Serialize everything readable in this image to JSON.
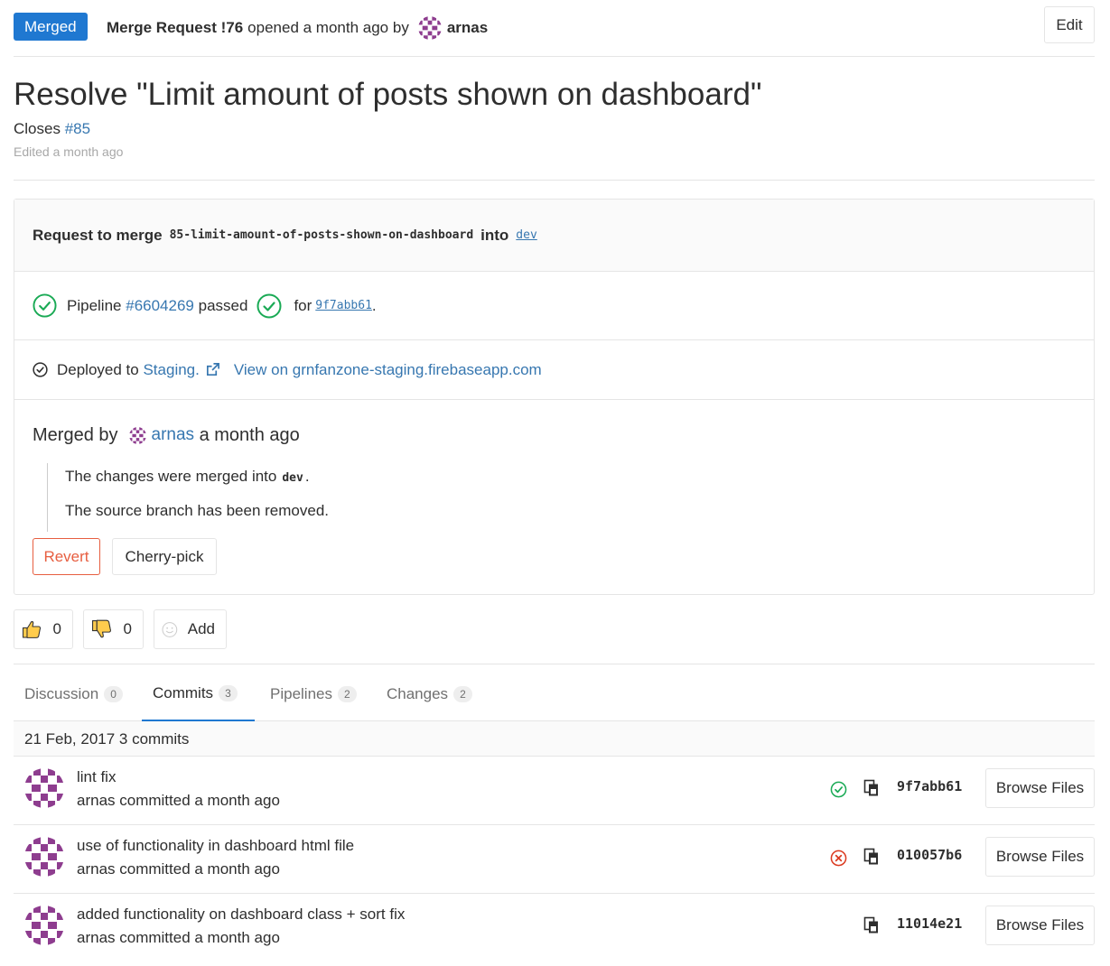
{
  "header": {
    "status_badge": "Merged",
    "mr_label": "Merge Request !76",
    "opened_text": "opened a month ago by",
    "author": "arnas",
    "edit_label": "Edit"
  },
  "title": "Resolve \"Limit amount of posts shown on dashboard\"",
  "closes": {
    "prefix": "Closes",
    "issue": "#85"
  },
  "edited": "Edited a month ago",
  "widget": {
    "request_prefix": "Request to merge",
    "source_branch": "85-limit-amount-of-posts-shown-on-dashboard",
    "into": "into",
    "target_branch": "dev",
    "pipeline_label": "Pipeline",
    "pipeline_id": "#6604269",
    "pipeline_status": "passed",
    "for_label": "for",
    "commit_sha": "9f7abb61",
    "deployed_prefix": "Deployed to",
    "environment": "Staging.",
    "view_link": "View on grnfanzone-staging.firebaseapp.com",
    "merged_by_prefix": "Merged by",
    "merged_by_user": "arnas",
    "merged_time": "a month ago",
    "note1_prefix": "The changes were merged into",
    "note1_branch": "dev",
    "note2": "The source branch has been removed.",
    "revert_label": "Revert",
    "cherry_pick_label": "Cherry-pick"
  },
  "awards": [
    {
      "icon": "thumbs-up-icon",
      "count": "0"
    },
    {
      "icon": "thumbs-down-icon",
      "count": "0"
    },
    {
      "icon": "smiley-icon",
      "label": "Add"
    }
  ],
  "tabs": [
    {
      "label": "Discussion",
      "count": "0"
    },
    {
      "label": "Commits",
      "count": "3",
      "active": true
    },
    {
      "label": "Pipelines",
      "count": "2"
    },
    {
      "label": "Changes",
      "count": "2"
    }
  ],
  "commits_header": "21 Feb, 2017 3 commits",
  "commits": [
    {
      "title": "lint fix",
      "author_line": "arnas committed a month ago",
      "status": "success",
      "sha": "9f7abb61",
      "browse": "Browse Files"
    },
    {
      "title": "use of functionality in dashboard html file",
      "author_line": "arnas committed a month ago",
      "status": "failed",
      "sha": "010057b6",
      "browse": "Browse Files"
    },
    {
      "title": "added functionality on dashboard class + sort fix",
      "author_line": "arnas committed a month ago",
      "status": "none",
      "sha": "11014e21",
      "browse": "Browse Files"
    }
  ],
  "colors": {
    "accent": "#1f78d1",
    "link": "#3777b0",
    "success": "#1aaa55",
    "danger": "#db3b21",
    "revert": "#e75e40"
  }
}
